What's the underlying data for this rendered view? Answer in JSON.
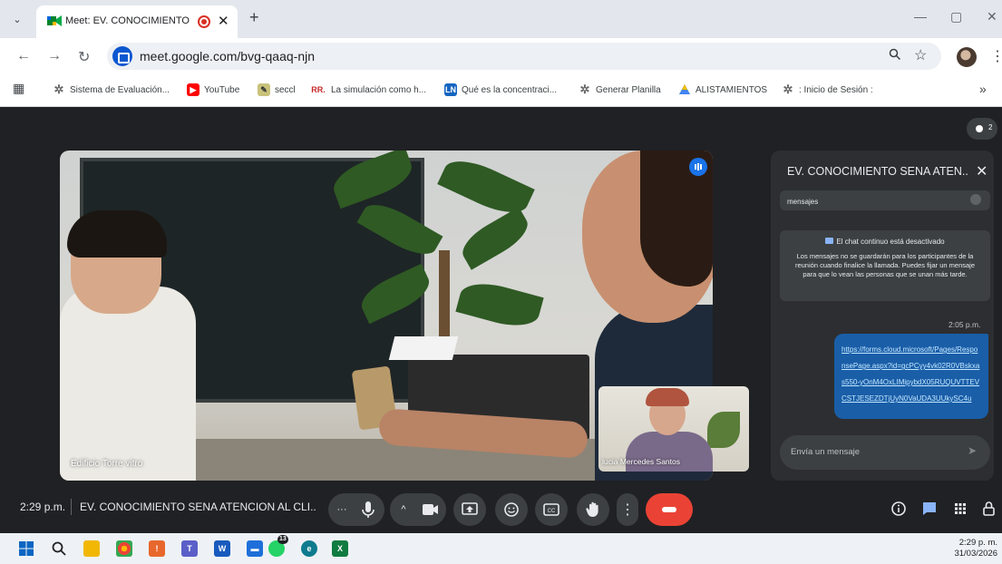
{
  "browser": {
    "tab_title": "Meet: EV. CONOCIMIENTO SE",
    "tab_close": "✕",
    "new_tab": "+",
    "url": "meet.google.com/bvg-qaaq-njn",
    "window": {
      "minimize": "—",
      "maximize": "▢",
      "close": "✕"
    }
  },
  "bookmarks": [
    {
      "label": "Sistema de Evaluación...",
      "icon": "sena-icon",
      "color": "#6b6b6b"
    },
    {
      "label": "YouTube",
      "icon": "youtube-icon",
      "color": "#ff0000"
    },
    {
      "label": "seccl",
      "icon": "seccl-icon",
      "color": "#8a9a3a"
    },
    {
      "label": "La simulación como h...",
      "icon": "rr-icon",
      "color": "#c62828"
    },
    {
      "label": "Qué es la concentraci...",
      "icon": "ln-icon",
      "color": "#1565c0"
    },
    {
      "label": "Generar Planilla",
      "icon": "sena-icon",
      "color": "#6b6b6b"
    },
    {
      "label": "ALISTAMIENTOS",
      "icon": "drive-icon",
      "color": "#1e8e3e"
    },
    {
      "label": ": Inicio de Sesión :",
      "icon": "sena-icon",
      "color": "#6b6b6b"
    }
  ],
  "bookmarks_more": "»",
  "meet": {
    "participant_count": "2",
    "main_participant": "Edificio Torre vitro",
    "pip_participant": "lucia Mercedes Santos",
    "time": "2:29 p.m.",
    "meeting_title": "EV. CONOCIMIENTO SENA ATENCION AL CLI..."
  },
  "chat": {
    "title": "EV. CONOCIMIENTO SENA ATEN...",
    "toggle_label": "mensajes",
    "notice_title": "El chat continuo está desactivado",
    "notice_body": "Los mensajes no se guardarán para los participantes de la reunión cuando finalice la llamada. Puedes fijar un mensaje para que lo vean las personas que se unan más tarde.",
    "message_time": "2:05 p.m.",
    "message_link": "https://forms.cloud.microsoft/Pages/ResponsePage.aspx?id=gcPCyy4vk02R0VBskxas550-yOnM4OxLIMipybdX05RUQUVTTEVCSTJESEZDTjUyN0VaUDA3UUkySC4u",
    "input_placeholder": "Envía un mensaje"
  },
  "controls": {
    "more_left": "···",
    "caret": "^",
    "more_vert": "⋮"
  },
  "taskbar": {
    "time": "2:29 p. m.",
    "date": "31/03/2026",
    "whatsapp_badge": "13"
  },
  "colors": {
    "meet_bg": "#202124",
    "end_call": "#ea4335",
    "message_bubble": "#1a5ea8",
    "accent_blue": "#1a73e8"
  }
}
